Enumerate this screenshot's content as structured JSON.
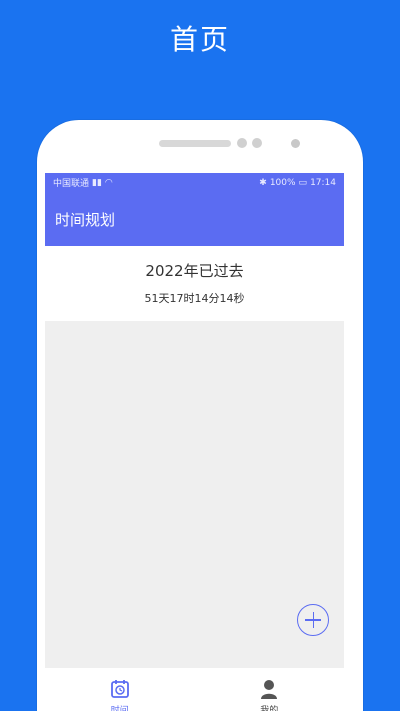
{
  "promo": {
    "title": "首页"
  },
  "status_bar": {
    "carrier": "中国联通",
    "battery": "100%",
    "time": "17:14"
  },
  "app_bar": {
    "title": "时间规划"
  },
  "summary": {
    "year_text": "2022年已过去",
    "elapsed_text": "51天17时14分14秒"
  },
  "bottom_nav": {
    "items": [
      {
        "label": "时间",
        "icon": "calendar-clock-icon",
        "active": true
      },
      {
        "label": "我的",
        "icon": "user-icon",
        "active": false
      }
    ]
  },
  "colors": {
    "background": "#1a73f0",
    "accent": "#5b6cf2",
    "list_bg": "#efefef"
  }
}
